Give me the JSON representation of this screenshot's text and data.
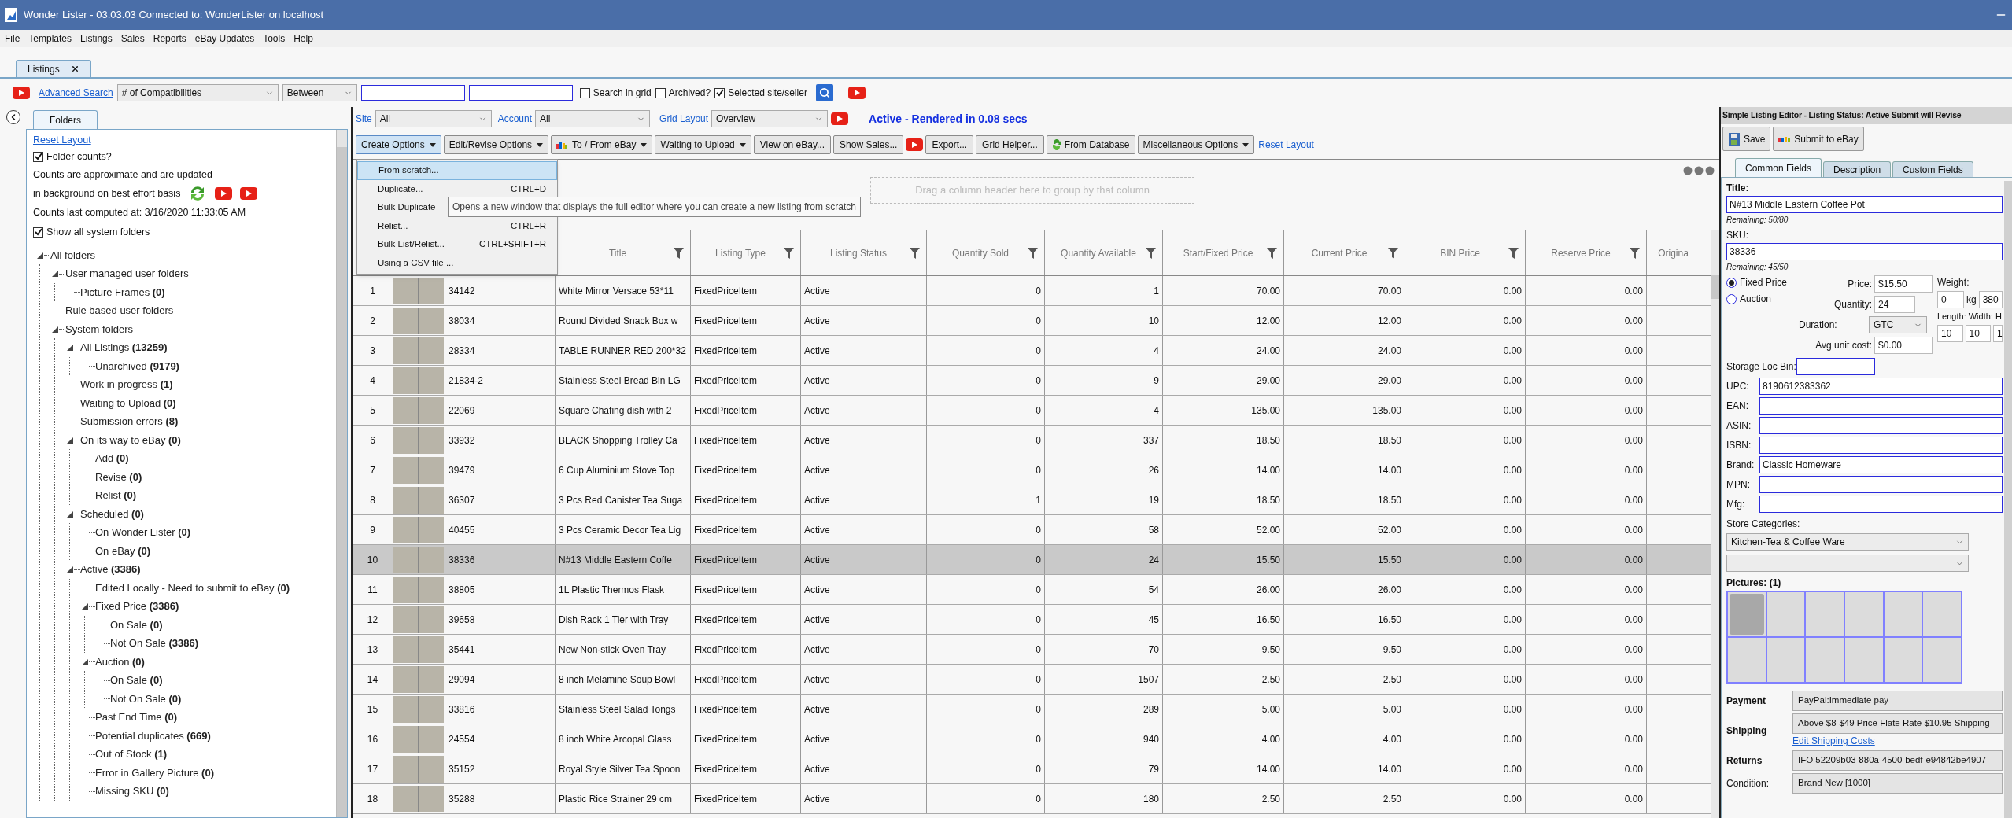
{
  "window": {
    "title": "Wonder Lister - 03.03.03 Connected to: WonderLister on localhost"
  },
  "menu": [
    "File",
    "Templates",
    "Listings",
    "Sales",
    "Reports",
    "eBay Updates",
    "Tools",
    "Help"
  ],
  "doc_tabs": [
    {
      "label": "Listings",
      "selected": true
    }
  ],
  "search_bar": {
    "link": "Advanced Search",
    "field": "# of Compatibilities",
    "operator": "Between",
    "checkboxes": [
      {
        "label": "Search in grid",
        "checked": false
      },
      {
        "label": "Archived?",
        "checked": false
      },
      {
        "label": "Selected site/seller",
        "checked": true
      }
    ]
  },
  "filter_bar": {
    "site_link": "Site",
    "site": "All",
    "account_link": "Account",
    "account": "All",
    "layout_link": "Grid Layout",
    "layout": "Overview",
    "status": "Active - Rendered in 0.08 secs"
  },
  "toolbar": [
    {
      "kind": "dropdown",
      "label": "Create Options",
      "open": true
    },
    {
      "kind": "dropdown",
      "label": "Edit/Revise Options",
      "open": false
    },
    {
      "kind": "dropdown",
      "label": "To / From eBay",
      "open": false
    },
    {
      "kind": "dropdown",
      "label": "Waiting to Upload",
      "open": false
    },
    {
      "kind": "button",
      "label": "View on eBay..."
    },
    {
      "kind": "button",
      "label": "Show Sales..."
    },
    {
      "kind": "video"
    },
    {
      "kind": "button",
      "label": "Export..."
    },
    {
      "kind": "button",
      "label": "Grid Helper..."
    },
    {
      "kind": "database",
      "label": "From Database"
    },
    {
      "kind": "dropdown",
      "label": "Miscellaneous Options",
      "open": false
    },
    {
      "kind": "link",
      "label": "Reset Layout"
    }
  ],
  "create_menu": {
    "items": [
      {
        "label": "From scratch...",
        "selected": true
      },
      {
        "label": "Duplicate...",
        "shortcut": "CTRL+D",
        "selected": false
      },
      {
        "label": "Bulk Duplicate",
        "selected": false
      },
      {
        "label": "Relist...",
        "shortcut": "CTRL+R",
        "selected": false
      },
      {
        "label": "Bulk List/Relist...",
        "shortcut": "CTRL+SHIFT+R",
        "selected": false
      },
      {
        "label": "Using a CSV file ...",
        "selected": false
      }
    ],
    "tooltip": "Opens a new window that displays the full editor where you can create a new listing from scratch"
  },
  "group_panel": {
    "placeholder": "Drag a column header here to group by that column"
  },
  "grid": {
    "columns": [
      "",
      "",
      "Title",
      "Listing Type",
      "Listing Status",
      "Quantity Sold",
      "Quantity Available",
      "Start/Fixed Price",
      "Current Price",
      "BIN Price",
      "Reserve Price",
      "Origina"
    ],
    "rows": [
      {
        "cells": [
          "1",
          "34142",
          "White Mirror Versace 53*11",
          "FixedPriceItem",
          "Active",
          "0",
          "1",
          "70.00",
          "70.00",
          "0.00",
          "0.00"
        ],
        "selected": false
      },
      {
        "cells": [
          "2",
          "38034",
          "Round Divided Snack Box w",
          "FixedPriceItem",
          "Active",
          "0",
          "10",
          "12.00",
          "12.00",
          "0.00",
          "0.00"
        ],
        "selected": false
      },
      {
        "cells": [
          "3",
          "28334",
          "TABLE RUNNER RED 200*32",
          "FixedPriceItem",
          "Active",
          "0",
          "4",
          "24.00",
          "24.00",
          "0.00",
          "0.00"
        ],
        "selected": false
      },
      {
        "cells": [
          "4",
          "21834-2",
          "Stainless Steel Bread Bin LG",
          "FixedPriceItem",
          "Active",
          "0",
          "9",
          "29.00",
          "29.00",
          "0.00",
          "0.00"
        ],
        "selected": false
      },
      {
        "cells": [
          "5",
          "22069",
          "Square Chafing dish with 2",
          "FixedPriceItem",
          "Active",
          "0",
          "4",
          "135.00",
          "135.00",
          "0.00",
          "0.00"
        ],
        "selected": false
      },
      {
        "cells": [
          "6",
          "33932",
          "BLACK Shopping Trolley Ca",
          "FixedPriceItem",
          "Active",
          "0",
          "337",
          "18.50",
          "18.50",
          "0.00",
          "0.00"
        ],
        "selected": false
      },
      {
        "cells": [
          "7",
          "39479",
          "6 Cup Aluminium Stove Top",
          "FixedPriceItem",
          "Active",
          "0",
          "26",
          "14.00",
          "14.00",
          "0.00",
          "0.00"
        ],
        "selected": false
      },
      {
        "cells": [
          "8",
          "36307",
          "3 Pcs Red Canister Tea Suga",
          "FixedPriceItem",
          "Active",
          "1",
          "19",
          "18.50",
          "18.50",
          "0.00",
          "0.00"
        ],
        "selected": false
      },
      {
        "cells": [
          "9",
          "40455",
          "3 Pcs Ceramic Decor Tea Lig",
          "FixedPriceItem",
          "Active",
          "0",
          "58",
          "52.00",
          "52.00",
          "0.00",
          "0.00"
        ],
        "selected": false
      },
      {
        "cells": [
          "10",
          "38336",
          "N#13 Middle Eastern Coffe",
          "FixedPriceItem",
          "Active",
          "0",
          "24",
          "15.50",
          "15.50",
          "0.00",
          "0.00"
        ],
        "selected": true
      },
      {
        "cells": [
          "11",
          "38805",
          "1L Plastic Thermos Flask",
          "FixedPriceItem",
          "Active",
          "0",
          "54",
          "26.00",
          "26.00",
          "0.00",
          "0.00"
        ],
        "selected": false
      },
      {
        "cells": [
          "12",
          "39658",
          "Dish Rack 1 Tier with Tray",
          "FixedPriceItem",
          "Active",
          "0",
          "45",
          "16.50",
          "16.50",
          "0.00",
          "0.00"
        ],
        "selected": false
      },
      {
        "cells": [
          "13",
          "35441",
          "New Non-stick Oven Tray",
          "FixedPriceItem",
          "Active",
          "0",
          "70",
          "9.50",
          "9.50",
          "0.00",
          "0.00"
        ],
        "selected": false
      },
      {
        "cells": [
          "14",
          "29094",
          "8 inch Melamine Soup Bowl",
          "FixedPriceItem",
          "Active",
          "0",
          "1507",
          "2.50",
          "2.50",
          "0.00",
          "0.00"
        ],
        "selected": false
      },
      {
        "cells": [
          "15",
          "33816",
          "Stainless Steel Salad Tongs",
          "FixedPriceItem",
          "Active",
          "0",
          "289",
          "5.00",
          "5.00",
          "0.00",
          "0.00"
        ],
        "selected": false
      },
      {
        "cells": [
          "16",
          "24554",
          "8 inch White Arcopal Glass",
          "FixedPriceItem",
          "Active",
          "0",
          "940",
          "4.00",
          "4.00",
          "0.00",
          "0.00"
        ],
        "selected": false
      },
      {
        "cells": [
          "17",
          "35152",
          "Royal Style Silver Tea Spoon",
          "FixedPriceItem",
          "Active",
          "0",
          "79",
          "14.00",
          "14.00",
          "0.00",
          "0.00"
        ],
        "selected": false
      },
      {
        "cells": [
          "18",
          "35288",
          "Plastic Rice Strainer 29 cm",
          "FixedPriceItem",
          "Active",
          "0",
          "180",
          "2.50",
          "2.50",
          "0.00",
          "0.00"
        ],
        "selected": false
      }
    ]
  },
  "folders_panel": {
    "tab": "Folders",
    "reset_link": "Reset Layout",
    "counts_checkbox": {
      "label": "Folder counts?",
      "checked": true
    },
    "note_lines": [
      "Counts are approximate and are updated",
      "in background on best effort basis"
    ],
    "computed": "Counts last computed at: 3/16/2020 11:33:05 AM",
    "show_all": {
      "label": "Show all system folders",
      "checked": true
    },
    "tree": [
      {
        "label": "All folders",
        "expanded": true,
        "children": [
          {
            "label": "User managed user folders",
            "expanded": true,
            "children": [
              {
                "label": "Picture Frames **(0)**"
              }
            ]
          },
          {
            "label": "Rule based user folders"
          },
          {
            "label": "System folders",
            "expanded": true,
            "children": [
              {
                "label": "All Listings **(13259)**",
                "expanded": true,
                "children": [
                  {
                    "label": "Unarchived **(9179)**"
                  }
                ]
              },
              {
                "label": "Work in progress **(1)**"
              },
              {
                "label": "Waiting to Upload **(0)**"
              },
              {
                "label": "Submission errors **(8)**"
              },
              {
                "label": "On its way to eBay **(0)**",
                "expanded": true,
                "children": [
                  {
                    "label": "Add **(0)**"
                  },
                  {
                    "label": "Revise **(0)**"
                  },
                  {
                    "label": "Relist **(0)**"
                  }
                ]
              },
              {
                "label": "Scheduled **(0)**",
                "expanded": true,
                "children": [
                  {
                    "label": "On Wonder Lister **(0)**"
                  },
                  {
                    "label": "On eBay **(0)**"
                  }
                ]
              },
              {
                "label": "Active **(3386)**",
                "expanded": true,
                "children": [
                  {
                    "label": "Edited Locally - Need to submit to eBay **(0)**"
                  },
                  {
                    "label": "Fixed Price **(3386)**",
                    "expanded": true,
                    "children": [
                      {
                        "label": "On Sale **(0)**"
                      },
                      {
                        "label": "Not On Sale **(3386)**"
                      }
                    ]
                  },
                  {
                    "label": "Auction **(0)**",
                    "expanded": true,
                    "children": [
                      {
                        "label": "On Sale **(0)**"
                      },
                      {
                        "label": "Not On Sale **(0)**"
                      }
                    ]
                  },
                  {
                    "label": "Past End Time **(0)**"
                  },
                  {
                    "label": "Potential duplicates **(669)**"
                  },
                  {
                    "label": "Out of Stock **(1)**"
                  },
                  {
                    "label": "Error in Gallery Picture **(0)**"
                  },
                  {
                    "label": "Missing SKU **(0)**"
                  }
                ]
              }
            ]
          }
        ]
      }
    ]
  },
  "editor": {
    "header": "Simple Listing Editor - Listing Status: Active Submit will Revise",
    "buttons": [
      {
        "kind": "save",
        "label": "Save"
      },
      {
        "kind": "submit",
        "label": "Submit to eBay"
      }
    ],
    "tabs": [
      {
        "label": "Common Fields",
        "selected": true
      },
      {
        "label": "Description",
        "selected": false
      },
      {
        "label": "Custom Fields",
        "selected": false
      }
    ],
    "title": {
      "label": "Title:",
      "value": "N#13 Middle Eastern Coffee Pot",
      "remaining": "Remaining: 50/80"
    },
    "sku": {
      "label": "SKU:",
      "value": "38336",
      "remaining": "Remaining: 45/50"
    },
    "format": [
      {
        "label": "Fixed Price",
        "selected": true
      },
      {
        "label": "Auction",
        "selected": false
      }
    ],
    "price": {
      "label": "Price:",
      "value": "$15.50"
    },
    "quantity": {
      "label": "Quantity:",
      "value": "24"
    },
    "duration": {
      "label": "Duration:",
      "value": "GTC"
    },
    "avg_cost": {
      "label": "Avg unit cost:",
      "value": "$0.00"
    },
    "weight": {
      "label": "Weight:",
      "major": "0",
      "unit": "kg",
      "minor": "380"
    },
    "dimensions": {
      "labels": [
        "Length:",
        "Width:",
        "H"
      ],
      "values": [
        "10",
        "10",
        "1"
      ]
    },
    "storage": {
      "label": "Storage Loc Bin:"
    },
    "ids": [
      {
        "label": "UPC:",
        "value": "8190612383362"
      },
      {
        "label": "EAN:"
      },
      {
        "label": "ASIN:"
      },
      {
        "label": "ISBN:"
      },
      {
        "label": "Brand:",
        "value": "Classic Homeware"
      },
      {
        "label": "MPN:"
      },
      {
        "label": "Mfg:"
      }
    ],
    "store_categories": {
      "label": "Store Categories:",
      "primary": "Kitchen-Tea & Coffee Ware"
    },
    "pictures": {
      "label": "Pictures: (1)"
    },
    "policies": [
      {
        "label": "Payment",
        "value": "PayPal:Immediate pay"
      },
      {
        "label": "Shipping",
        "value": "Above $8-$49 Price Flate Rate $10.95 Shipping",
        "link": "Edit Shipping Costs"
      },
      {
        "label": "Returns",
        "value": "IFO 52209b03-880a-4500-bedf-e94842be4907"
      },
      {
        "label": "Condition:",
        "value": "Brand New [1000]"
      }
    ]
  }
}
